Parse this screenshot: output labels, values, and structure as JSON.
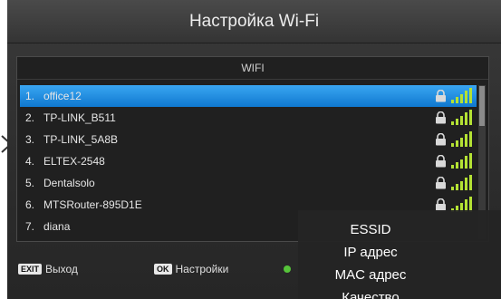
{
  "header": {
    "title": "Настройка Wi-Fi"
  },
  "panel": {
    "header": "WIFI"
  },
  "networks": [
    {
      "num": "1.",
      "ssid": "office12",
      "selected": true
    },
    {
      "num": "2.",
      "ssid": "TP-LINK_B511",
      "selected": false
    },
    {
      "num": "3.",
      "ssid": "TP-LINK_5A8B",
      "selected": false
    },
    {
      "num": "4.",
      "ssid": "ELTEX-2548",
      "selected": false
    },
    {
      "num": "5.",
      "ssid": "Dentalsolo",
      "selected": false
    },
    {
      "num": "6.",
      "ssid": "MTSRouter-895D1E",
      "selected": false
    },
    {
      "num": "7.",
      "ssid": "diana",
      "selected": false
    }
  ],
  "footer": {
    "exit_key": "EXIT",
    "exit_label": "Выход",
    "ok_key": "OK",
    "ok_label": "Настройки"
  },
  "overlay_menu": {
    "items": [
      "ESSID",
      "IP адрес",
      "MAC адрес",
      "Качество"
    ]
  },
  "colors": {
    "selection": "#1a8be0",
    "signal": "#b4e234",
    "lock": "#d9d9d9",
    "green_key": "#56c43a"
  },
  "icons": {
    "lock": "lock-icon",
    "signal": "signal-strength-icon",
    "pointer": "chevron-right-icon"
  }
}
